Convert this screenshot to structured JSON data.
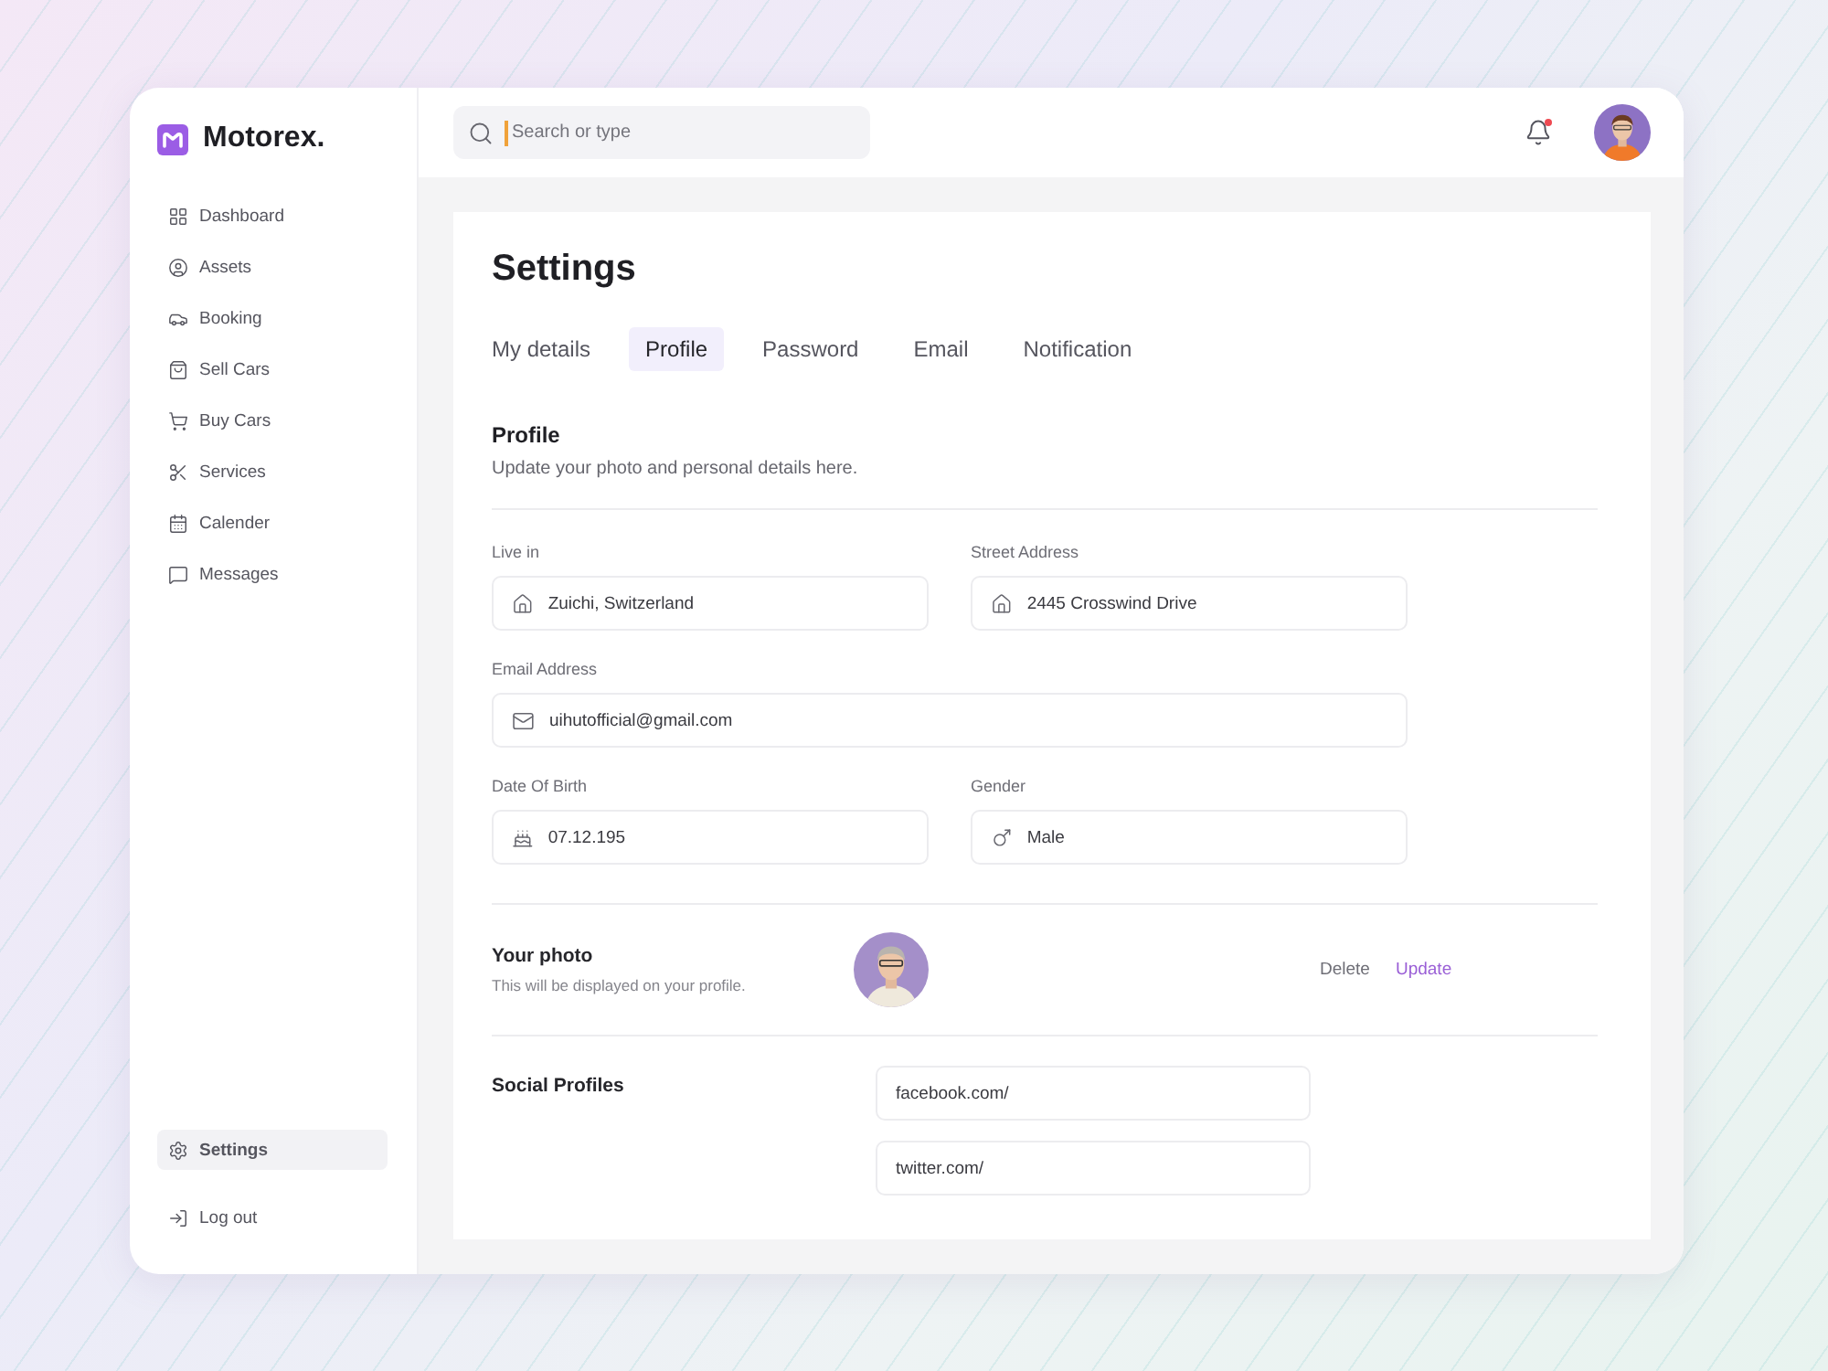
{
  "brand": {
    "name": "Motorex."
  },
  "sidebar": {
    "items": [
      {
        "label": "Dashboard",
        "kind": "grid",
        "selected": false
      },
      {
        "label": "Assets",
        "kind": "user",
        "selected": false
      },
      {
        "label": "Booking",
        "kind": "car",
        "selected": false
      },
      {
        "label": "Sell Cars",
        "kind": "bag",
        "selected": false
      },
      {
        "label": "Buy Cars",
        "kind": "cart",
        "selected": false
      },
      {
        "label": "Services",
        "kind": "scissors",
        "selected": false
      },
      {
        "label": "Calender",
        "kind": "calendar",
        "selected": false
      },
      {
        "label": "Messages",
        "kind": "message",
        "selected": false
      }
    ],
    "bottom_items": [
      {
        "label": "Settings",
        "kind": "settings",
        "selected": true
      },
      {
        "label": "Log out",
        "kind": "logout",
        "selected": false
      }
    ]
  },
  "topbar": {
    "search": {
      "placeholder": "Search or type"
    },
    "notifications": {
      "unread": true
    }
  },
  "page": {
    "title": "Settings",
    "tabs": [
      {
        "label": "My details",
        "selected": false
      },
      {
        "label": "Profile",
        "selected": true
      },
      {
        "label": "Password",
        "selected": false
      },
      {
        "label": "Email",
        "selected": false
      },
      {
        "label": "Notification",
        "selected": false
      }
    ],
    "section": {
      "title": "Profile",
      "subtitle": "Update your photo and personal details here."
    },
    "field_rows": [
      [
        {
          "label": "Live in",
          "value": "Zuichi, Switzerland",
          "kind": "home"
        },
        {
          "label": "Street Address",
          "value": "2445 Crosswind Drive",
          "kind": "home"
        }
      ],
      [
        {
          "label": "Email Address",
          "value": "uihutofficial@gmail.com",
          "kind": "mail"
        }
      ],
      [
        {
          "label": "Date Of Birth",
          "value": "07.12.195",
          "kind": "cake"
        },
        {
          "label": "Gender",
          "value": "Male",
          "kind": "male"
        }
      ]
    ],
    "photo": {
      "title": "Your photo",
      "hint": "This will be displayed on your profile.",
      "actions": [
        {
          "label": "Delete",
          "kind": "secondary"
        },
        {
          "label": "Update",
          "kind": "primary"
        }
      ]
    },
    "social": {
      "title": "Social Profiles",
      "fields": [
        {
          "value": "facebook.com/"
        },
        {
          "value": "twitter.com/"
        }
      ]
    }
  }
}
